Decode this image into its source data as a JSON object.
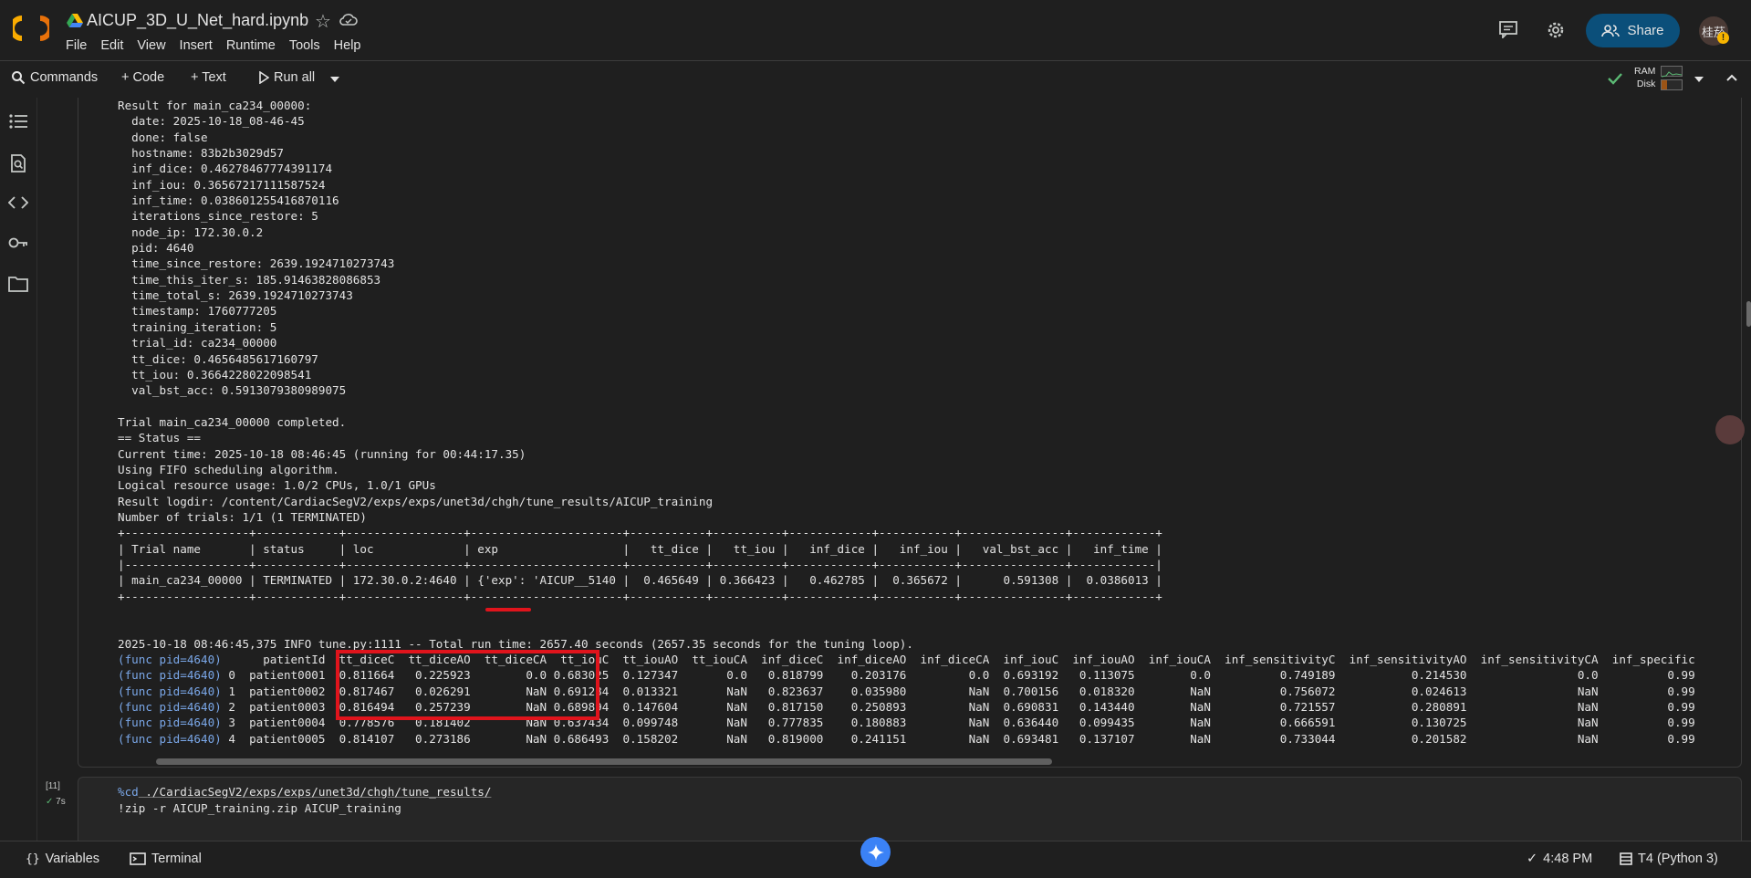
{
  "header": {
    "notebook_title": "AICUP_3D_U_Net_hard.ipynb",
    "menus": [
      "File",
      "Edit",
      "View",
      "Insert",
      "Runtime",
      "Tools",
      "Help"
    ],
    "share_label": "Share",
    "avatar_text": "桂菸",
    "avatar_badge": "!"
  },
  "toolbar": {
    "commands_label": "Commands",
    "code_label": "+ Code",
    "text_label": "+ Text",
    "run_all_label": "Run all",
    "ram_label": "RAM",
    "disk_label": "Disk"
  },
  "output": {
    "lines": [
      "Result for main_ca234_00000:",
      "  date: 2025-10-18_08-46-45",
      "  done: false",
      "  hostname: 83b2b3029d57",
      "  inf_dice: 0.46278467774391174",
      "  inf_iou: 0.36567217111587524",
      "  inf_time: 0.038601255416870116",
      "  iterations_since_restore: 5",
      "  node_ip: 172.30.0.2",
      "  pid: 4640",
      "  time_since_restore: 2639.1924710273743",
      "  time_this_iter_s: 185.91463828086853",
      "  time_total_s: 2639.1924710273743",
      "  timestamp: 1760777205",
      "  training_iteration: 5",
      "  trial_id: ca234_00000",
      "  tt_dice: 0.4656485617160797",
      "  tt_iou: 0.3664228022098541",
      "  val_bst_acc: 0.5913079380989075",
      "",
      "Trial main_ca234_00000 completed.",
      "== Status ==",
      "Current time: 2025-10-18 08:46:45 (running for 00:44:17.35)",
      "Using FIFO scheduling algorithm.",
      "Logical resource usage: 1.0/2 CPUs, 1.0/1 GPUs",
      "Result logdir: /content/CardiacSegV2/exps/exps/unet3d/chgh/tune_results/AICUP_training",
      "Number of trials: 1/1 (1 TERMINATED)",
      "+------------------+------------+-----------------+----------------------+-----------+----------+------------+-----------+---------------+------------+",
      "| Trial name       | status     | loc             | exp                  |   tt_dice |   tt_iou |   inf_dice |   inf_iou |   val_bst_acc |   inf_time |",
      "|------------------+------------+-----------------+----------------------+-----------+----------+------------+-----------+---------------+------------|",
      "| main_ca234_00000 | TERMINATED | 172.30.0.2:4640 | {'exp': 'AICUP__5140 |  0.465649 | 0.366423 |   0.462785 |  0.365672 |      0.591308 |  0.0386013 |",
      "+------------------+------------+-----------------+----------------------+-----------+----------+------------+-----------+---------------+------------+",
      "",
      "",
      "2025-10-18 08:46:45,375 INFO tune.py:1111 -- Total run time: 2657.40 seconds (2657.35 seconds for the tuning loop)."
    ],
    "df_rows": [
      [
        "(func pid=4640)",
        "      patientId  tt_diceC  tt_diceAO  tt_diceCA  tt_iouC  tt_iouAO  tt_iouCA  inf_diceC  inf_diceAO  inf_diceCA  inf_iouC  inf_iouAO  inf_iouCA  inf_sensitivityC  inf_sensitivityAO  inf_sensitivityCA  inf_specific"
      ],
      [
        "(func pid=4640)",
        " 0  patient0001  0.811664   0.225923        0.0 0.683025  0.127347       0.0   0.818799    0.203176         0.0  0.693192   0.113075        0.0          0.749189           0.214530                0.0          0.99"
      ],
      [
        "(func pid=4640)",
        " 1  patient0002  0.817467   0.026291        NaN 0.691284  0.013321       NaN   0.823637    0.035980         NaN  0.700156   0.018320        NaN          0.756072           0.024613                NaN          0.99"
      ],
      [
        "(func pid=4640)",
        " 2  patient0003  0.816494   0.257239        NaN 0.689894  0.147604       NaN   0.817150    0.250893         NaN  0.690831   0.143440        NaN          0.721557           0.280891                NaN          0.99"
      ],
      [
        "(func pid=4640)",
        " 3  patient0004  0.778576   0.181402        NaN 0.637434  0.099748       NaN   0.777835    0.180883         NaN  0.636440   0.099435        NaN          0.666591           0.130725                NaN          0.99"
      ],
      [
        "(func pid=4640)",
        " 4  patient0005  0.814107   0.273186        NaN 0.686493  0.158202       NaN   0.819000    0.241151         NaN  0.693481   0.137107        NaN          0.733044           0.201582                NaN          0.99"
      ]
    ]
  },
  "cell2": {
    "exec_count": "[11]",
    "exec_time": "7s",
    "line1_magic": "%cd",
    "line1_rest": " ./CardiacSegV2/exps/exps/unet3d/chgh/tune_results/",
    "line2": "!zip -r AICUP_training.zip AICUP_training"
  },
  "statusbar": {
    "variables_label": "Variables",
    "terminal_label": "Terminal",
    "time_label": "4:48 PM",
    "runtime_label": "T4 (Python 3)"
  },
  "colors": {
    "accent_red": "#e0141c",
    "share_bg": "#0b4f7a",
    "link_blue": "#7aa7e8"
  }
}
